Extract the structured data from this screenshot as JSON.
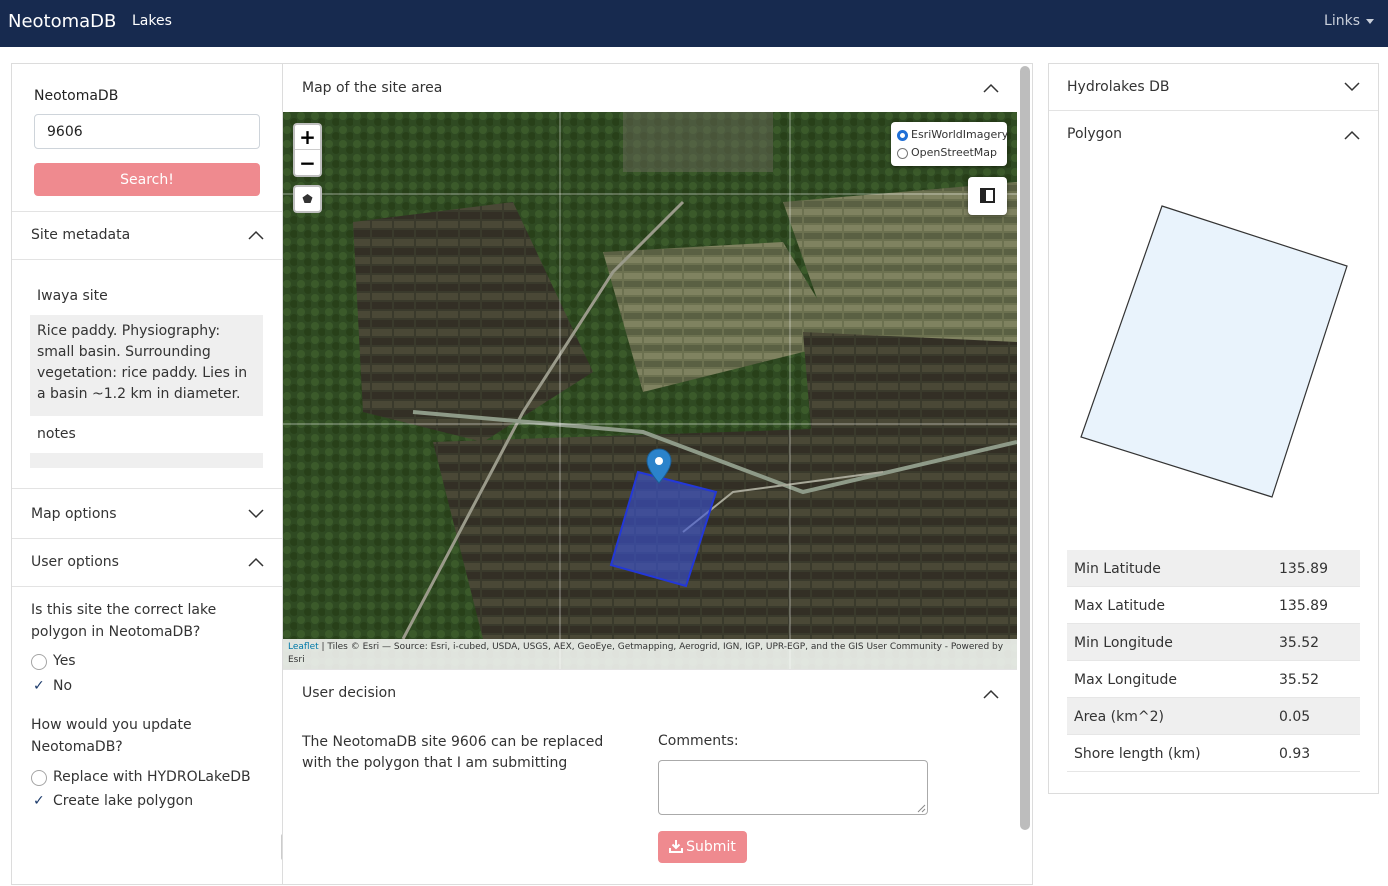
{
  "navbar": {
    "brand": "NeotomaDB",
    "link": "Lakes",
    "right": "Links"
  },
  "search": {
    "label": "NeotomaDB",
    "value": "9606",
    "button": "Search!"
  },
  "site_metadata": {
    "title": "Site metadata",
    "name": "Iwaya site",
    "description": "Rice paddy. Physiography: small basin. Surrounding vegetation: rice paddy. Lies in a basin ~1.2 km in diameter.",
    "notes_label": "notes"
  },
  "map_options": {
    "title": "Map options"
  },
  "user_options": {
    "title": "User options",
    "q1": "Is this site the correct lake polygon in NeotomaDB?",
    "q1_options": [
      "Yes",
      "No"
    ],
    "q2": "How would you update NeotomaDB?",
    "q2_options": [
      "Replace with HYDROLakeDB",
      "Create lake polygon"
    ]
  },
  "map_panel": {
    "title": "Map of the site area",
    "zoom_in": "+",
    "zoom_out": "−",
    "layers": [
      "EsriWorldImagery",
      "OpenStreetMap"
    ],
    "attribution_link": "Leaflet",
    "attribution": " | Tiles © Esri — Source: Esri, i-cubed, USDA, USGS, AEX, GeoEye, Getmapping, Aerogrid, IGN, IGP, UPR-EGP, and the GIS User Community - Powered by Esri"
  },
  "user_decision": {
    "title": "User decision",
    "text": "The NeotomaDB site 9606 can be replaced with the polygon that I am submitting",
    "comments_label": "Comments:",
    "submit": "Submit"
  },
  "right_panel": {
    "hydrolakes_title": "Hydrolakes DB",
    "polygon_title": "Polygon",
    "rows": [
      {
        "label": "Min Latitude",
        "value": "135.89"
      },
      {
        "label": "Max Latitude",
        "value": "135.89"
      },
      {
        "label": "Min Longitude",
        "value": "35.52"
      },
      {
        "label": "Max Longitude",
        "value": "35.52"
      },
      {
        "label": "Area (km^2)",
        "value": "0.05"
      },
      {
        "label": "Shore length (km)",
        "value": "0.93"
      }
    ]
  },
  "colors": {
    "navbar": "#172a4f",
    "accent": "#ef8a8f",
    "polygon_fill": "#e9f3fc"
  }
}
